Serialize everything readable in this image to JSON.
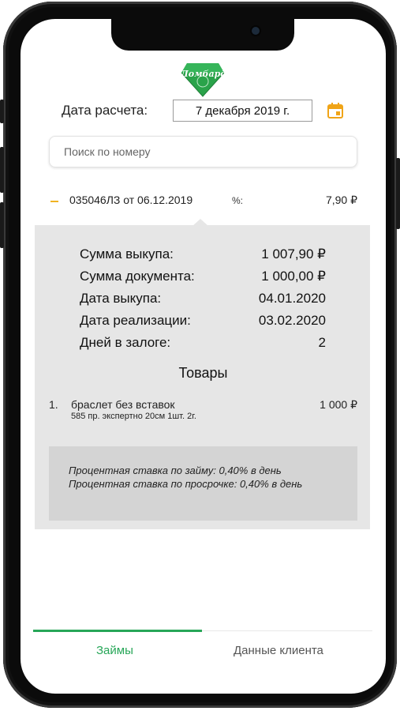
{
  "brand": {
    "logo_text": "Ломбард",
    "logo_color": "#2aa34a"
  },
  "calc_date": {
    "label": "Дата расчета:",
    "value": "7 декабря 2019 г.",
    "icon": "calendar-icon",
    "icon_color": "#f0a417"
  },
  "search": {
    "placeholder": "Поиск по номеру"
  },
  "loan": {
    "collapse_icon": "minus-icon",
    "title": "035046ЛЗ от 06.12.2019",
    "percent_label": "%:",
    "amount": "7,90 ₽",
    "details": [
      {
        "key": "Сумма выкупа:",
        "value": "1 007,90 ₽"
      },
      {
        "key": "Сумма документа:",
        "value": "1 000,00 ₽"
      },
      {
        "key": "Дата выкупа:",
        "value": "04.01.2020"
      },
      {
        "key": "Дата реализации:",
        "value": "03.02.2020"
      },
      {
        "key": "Дней в залоге:",
        "value": "2"
      }
    ],
    "goods_title": "Товары",
    "goods": [
      {
        "num": "1.",
        "name": "браслет без вставок",
        "desc": "585 пр. экспертно 20см 1шт. 2г.",
        "price": "1 000 ₽"
      }
    ],
    "rates": [
      "Процентная ставка по займу: 0,40% в день",
      "Процентная ставка по просрочке: 0,40% в день"
    ]
  },
  "tabs": {
    "loans": "Займы",
    "client": "Данные клиента",
    "active_color": "#27a658"
  }
}
